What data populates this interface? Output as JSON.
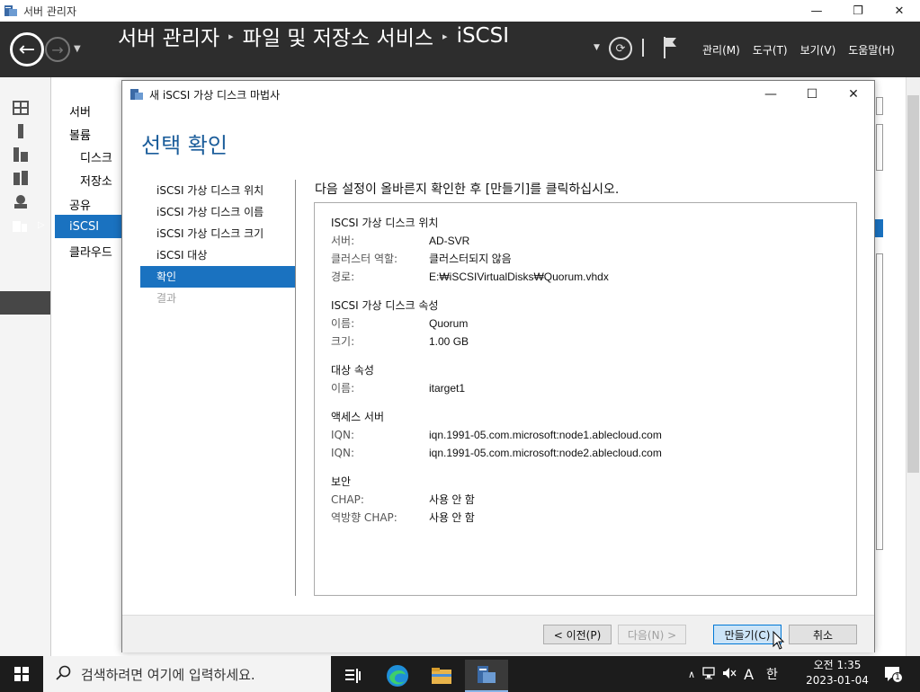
{
  "outer_window": {
    "title": "서버 관리자"
  },
  "header": {
    "breadcrumb": [
      "서버 관리자",
      "파일 및 저장소 서비스",
      "iSCSI"
    ],
    "menu": [
      "관리(M)",
      "도구(T)",
      "보기(V)",
      "도움말(H)"
    ]
  },
  "leftnav": {
    "items": [
      "서버",
      "볼륨",
      "디스크",
      "저장소",
      "공유",
      "iSCSI",
      "클라우드"
    ]
  },
  "wizard": {
    "title": "새 iSCSI 가상 디스크 마법사",
    "heading": "선택 확인",
    "steps": [
      {
        "label": "iSCSI 가상 디스크 위치",
        "state": "normal"
      },
      {
        "label": "iSCSI 가상 디스크 이름",
        "state": "normal"
      },
      {
        "label": "iSCSI 가상 디스크 크기",
        "state": "normal"
      },
      {
        "label": "iSCSI 대상",
        "state": "normal"
      },
      {
        "label": "확인",
        "state": "active"
      },
      {
        "label": "결과",
        "state": "disabled"
      }
    ],
    "instruction": "다음 설정이 올바른지 확인한 후 [만들기]를 클릭하십시오.",
    "summary": {
      "location": {
        "title": "ISCSI 가상 디스크 위치",
        "rows": [
          {
            "k": "서버:",
            "v": "AD-SVR"
          },
          {
            "k": "클러스터 역할:",
            "v": "클러스터되지 않음"
          },
          {
            "k": "경로:",
            "v": "E:₩iSCSIVirtualDisks₩Quorum.vhdx"
          }
        ]
      },
      "properties": {
        "title": "ISCSI 가상 디스크 속성",
        "rows": [
          {
            "k": "이름:",
            "v": "Quorum"
          },
          {
            "k": "크기:",
            "v": "1.00 GB"
          }
        ]
      },
      "target": {
        "title": "대상 속성",
        "rows": [
          {
            "k": "이름:",
            "v": "itarget1"
          }
        ]
      },
      "access": {
        "title": "액세스 서버",
        "rows": [
          {
            "k": "IQN:",
            "v": "iqn.1991-05.com.microsoft:node1.ablecloud.com"
          },
          {
            "k": "IQN:",
            "v": "iqn.1991-05.com.microsoft:node2.ablecloud.com"
          }
        ]
      },
      "security": {
        "title": "보안",
        "rows": [
          {
            "k": "CHAP:",
            "v": "사용 안 함"
          },
          {
            "k": "역방향 CHAP:",
            "v": "사용 안 함"
          }
        ]
      }
    },
    "buttons": {
      "prev": "< 이전(P)",
      "next": "다음(N) >",
      "create": "만들기(C)",
      "cancel": "취소"
    }
  },
  "taskbar": {
    "search_placeholder": "검색하려면 여기에 입력하세요.",
    "ime_mode": "A",
    "ime_lang": "한",
    "clock_time": "오전 1:35",
    "clock_date": "2023-01-04",
    "notification_count": "1"
  },
  "colors": {
    "accent": "#1a72c0",
    "header_bg": "#2d2d2d",
    "heading": "#1a5c9a"
  }
}
